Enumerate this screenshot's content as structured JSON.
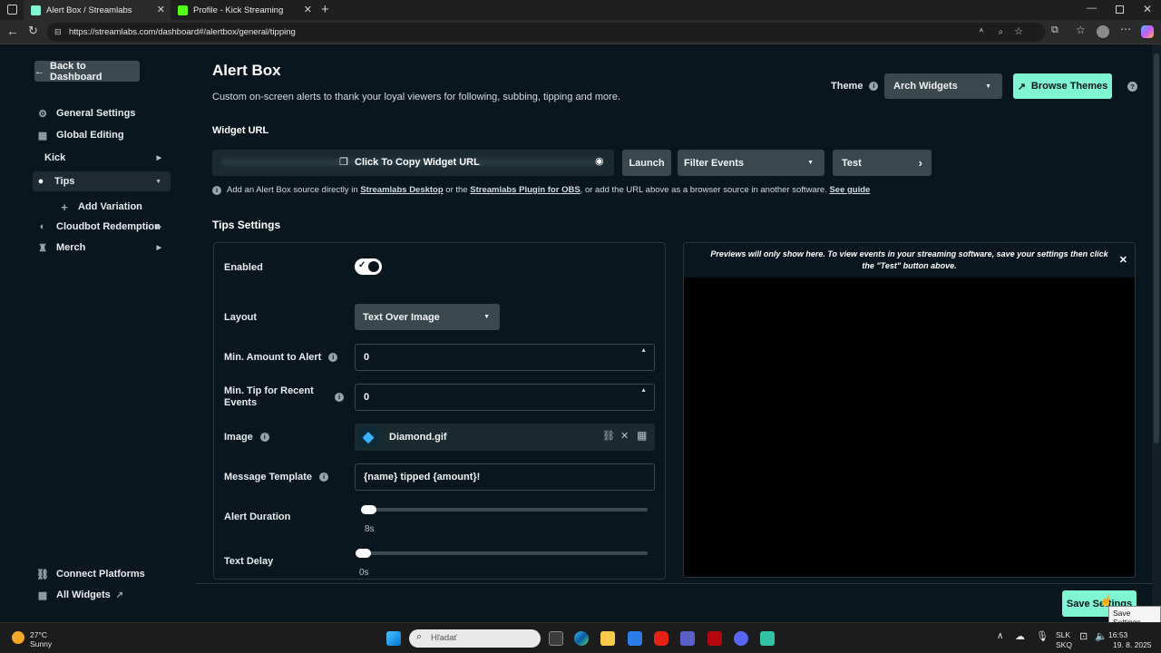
{
  "browser": {
    "tabs": [
      {
        "label": "Alert Box / Streamlabs",
        "active": true
      },
      {
        "label": "Profile - Kick Streaming",
        "active": false
      }
    ],
    "url": "https://streamlabs.com/dashboard#/alertbox/general/tipping"
  },
  "sidebar": {
    "back_label": "Back to Dashboard",
    "items": [
      {
        "label": "General Settings",
        "icon": "gear-icon"
      },
      {
        "label": "Global Editing",
        "icon": "grid-icon"
      },
      {
        "label": "Kick",
        "icon": ""
      },
      {
        "label": "Tips",
        "icon": "coins-icon"
      },
      {
        "label": "Add Variation",
        "icon": "plus-icon"
      },
      {
        "label": "Cloudbot Redemption",
        "icon": "bot-icon"
      },
      {
        "label": "Merch",
        "icon": "shirt-icon"
      }
    ],
    "footer": [
      {
        "label": "Connect Platforms",
        "icon": "link-icon"
      },
      {
        "label": "All Widgets",
        "icon": "widgets-icon"
      }
    ]
  },
  "header": {
    "title": "Alert Box",
    "description": "Custom on-screen alerts to thank your loyal viewers for following, subbing, tipping and more.",
    "theme_label": "Theme",
    "theme_value": "Arch Widgets",
    "browse_themes_label": "Browse Themes"
  },
  "widget_url": {
    "title": "Widget URL",
    "copy_label": "Click To Copy Widget URL",
    "launch_label": "Launch",
    "filter_label": "Filter Events",
    "test_label": "Test",
    "hint_prefix": "Add an Alert Box source directly in ",
    "hint_link1": "Streamlabs Desktop",
    "hint_mid": " or the ",
    "hint_link2": "Streamlabs Plugin for OBS",
    "hint_suffix": ", or add the URL above as a browser source in another software. ",
    "hint_link3": "See guide"
  },
  "tips_settings": {
    "title": "Tips Settings",
    "enabled_label": "Enabled",
    "enabled": true,
    "layout_label": "Layout",
    "layout_value": "Text Over Image",
    "min_amount_label": "Min. Amount to Alert",
    "min_amount_value": "0",
    "min_tip_label_line1": "Min. Tip for Recent",
    "min_tip_label_line2": "Events",
    "min_tip_value": "0",
    "image_label": "Image",
    "image_value": "Diamond.gif",
    "message_template_label": "Message Template",
    "message_template_value": "{name} tipped {amount}!",
    "alert_duration_label": "Alert Duration",
    "alert_duration_value": "8s",
    "text_delay_label": "Text Delay",
    "text_delay_value": "0s"
  },
  "preview": {
    "note": "Previews will only show here. To view events in your streaming software, save your settings then click the \"Test\" button above."
  },
  "save": {
    "label": "Save Settings",
    "tooltip": "Save Settings"
  },
  "taskbar": {
    "weather_temp": "27°C",
    "weather_desc": "Sunny",
    "search_placeholder": "Hľadať",
    "lang_top": "SLK",
    "lang_bottom": "SKQ",
    "time": "16:53",
    "date": "19. 8. 2025"
  },
  "colors": {
    "background": "#09161d",
    "accent": "#80f5d2"
  }
}
